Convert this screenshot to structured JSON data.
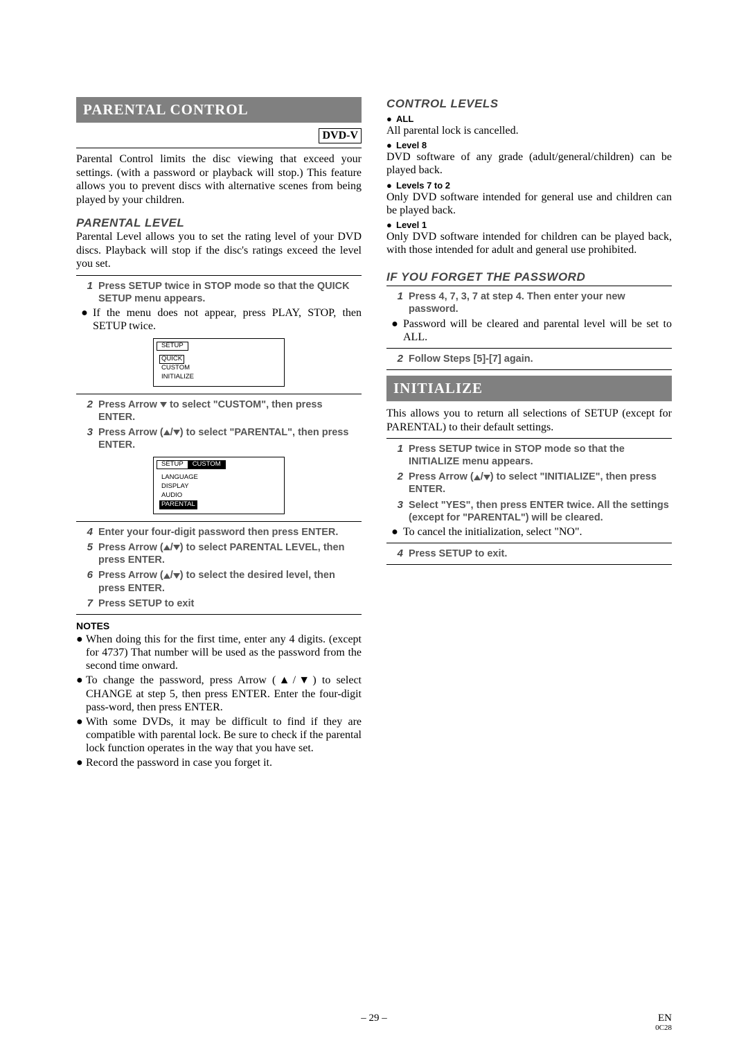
{
  "left": {
    "banner": "PARENTAL CONTROL",
    "dvdv": "DVD-V",
    "intro": "Parental Control limits the disc viewing that exceed your settings. (with a password or playback will stop.) This feature allows you to prevent discs with alternative scenes from being played by your children.",
    "sub1": "PARENTAL LEVEL",
    "sub1_body": "Parental Level allows you to set the rating level of your DVD discs. Playback will stop if the disc's ratings exceed the level you set.",
    "steps": {
      "s1": "Press SETUP twice in STOP mode so that the QUICK SETUP menu appears.",
      "s1_sub": "If the menu does not appear, press PLAY, STOP, then SETUP twice.",
      "s2_a": "Press Arrow ",
      "s2_b": " to select \"CUSTOM\", then press ENTER.",
      "s3_a": "Press Arrow (",
      "s3_b": ") to select \"PARENTAL\", then press ENTER.",
      "s4": "Enter your four-digit password then press ENTER.",
      "s5_a": "Press Arrow (",
      "s5_b": ") to select PARENTAL LEVEL, then press ENTER.",
      "s6_a": "Press Arrow (",
      "s6_b": ") to select the desired level, then press ENTER.",
      "s7": "Press SETUP to exit"
    },
    "osd1": {
      "tab": "SETUP",
      "items": [
        "QUICK",
        "CUSTOM",
        "INITIALIZE"
      ],
      "boxed": 0
    },
    "osd2": {
      "tabs": [
        "SETUP",
        "CUSTOM"
      ],
      "sel_tab": 1,
      "items": [
        "LANGUAGE",
        "DISPLAY",
        "AUDIO",
        "PARENTAL"
      ],
      "sel": 3
    },
    "notes_head": "NOTES",
    "notes": [
      "When doing this for the first time, enter any 4 digits. (except for 4737) That number will be used as the password from the second time onward.",
      "To change the password, press Arrow (▲/▼) to select CHANGE at step 5, then press ENTER. Enter the four-digit pass-word, then press ENTER.",
      "With some DVDs, it may be difficult to find if they are compatible with parental lock. Be sure to check if the parental lock function operates in the way that you have set.",
      "Record the password in case you forget it."
    ]
  },
  "right": {
    "sub_levels": "CONTROL LEVELS",
    "levels": [
      {
        "label": "ALL",
        "desc": "All parental lock is cancelled."
      },
      {
        "label": "Level 8",
        "desc": "DVD software of any grade (adult/general/children) can be played back."
      },
      {
        "label": "Levels 7 to 2",
        "desc": "Only DVD software intended for general use and children can be played back."
      },
      {
        "label": "Level 1",
        "desc": "Only DVD software intended for children can be played back, with those intended for adult and general use prohibited."
      }
    ],
    "sub_forget": "IF YOU FORGET THE PASSWORD",
    "forget_s1": "Press 4, 7, 3, 7 at step 4. Then enter your new password.",
    "forget_sub": "Password will be cleared and parental level will be set to ALL.",
    "forget_s2": "Follow Steps [5]-[7] again.",
    "banner2": "INITIALIZE",
    "init_body": "This allows you to return all selections of SETUP (except for PARENTAL) to their default settings.",
    "init_s1": "Press SETUP twice in STOP mode so that the INITIALIZE menu appears.",
    "init_s2_a": "Press Arrow (",
    "init_s2_b": ") to select \"INITIALIZE\", then press ENTER.",
    "init_s3": "Select \"YES\", then press ENTER twice. All the settings (except for \"PARENTAL\") will be cleared.",
    "init_sub": "To cancel the initialization, select \"NO\".",
    "init_s4": "Press SETUP to exit."
  },
  "footer": {
    "page": "– 29 –",
    "lang": "EN",
    "code": "0C28"
  }
}
